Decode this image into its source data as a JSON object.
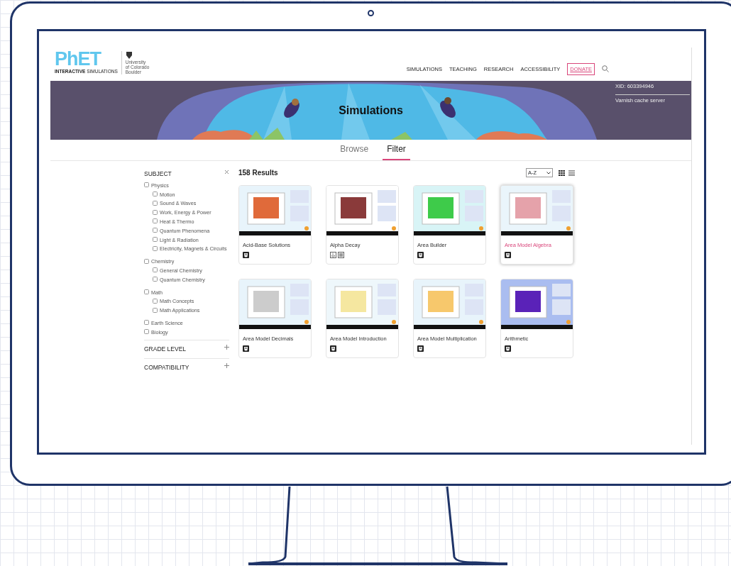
{
  "header": {
    "logo": {
      "name": "PhET",
      "tagline_bold": "INTERACTIVE",
      "tagline": "SIMULATIONS",
      "university": [
        "University",
        "of Colorado",
        "Boulder"
      ]
    },
    "nav": [
      {
        "label": "SIMULATIONS",
        "kind": "link"
      },
      {
        "label": "TEACHING",
        "kind": "link"
      },
      {
        "label": "RESEARCH",
        "kind": "link"
      },
      {
        "label": "ACCESSIBILITY",
        "kind": "link"
      },
      {
        "label": "DONATE",
        "kind": "outlined"
      }
    ]
  },
  "banner": {
    "title": "Simulations",
    "server_info": [
      "XID: 603394946",
      "Varnish cache server"
    ]
  },
  "tabs": [
    {
      "label": "Browse",
      "selected": false
    },
    {
      "label": "Filter",
      "selected": true
    }
  ],
  "filters": {
    "sections": [
      {
        "title": "SUBJECT",
        "expanded": true,
        "items": [
          {
            "label": "Physics",
            "checked": false,
            "children": [
              {
                "label": "Motion",
                "checked": false
              },
              {
                "label": "Sound & Waves",
                "checked": false
              },
              {
                "label": "Work, Energy & Power",
                "checked": false
              },
              {
                "label": "Heat & Thermo",
                "checked": false
              },
              {
                "label": "Quantum Phenomena",
                "checked": false
              },
              {
                "label": "Light & Radiation",
                "checked": false
              },
              {
                "label": "Electricity, Magnets & Circuits",
                "checked": false
              }
            ]
          },
          {
            "label": "Chemistry",
            "checked": false,
            "children": [
              {
                "label": "General Chemistry",
                "checked": false
              },
              {
                "label": "Quantum Chemistry",
                "checked": false
              }
            ]
          },
          {
            "label": "Math",
            "checked": false,
            "children": [
              {
                "label": "Math Concepts",
                "checked": false
              },
              {
                "label": "Math Applications",
                "checked": false
              }
            ]
          },
          {
            "label": "Earth Science",
            "checked": false
          },
          {
            "label": "Biology",
            "checked": false
          }
        ]
      },
      {
        "title": "GRADE LEVEL",
        "expanded": false
      },
      {
        "title": "COMPATIBILITY",
        "expanded": false
      }
    ]
  },
  "results": {
    "count": "158 Results",
    "sort": "A-Z",
    "views": [
      {
        "kind": "grid",
        "selected": true
      },
      {
        "kind": "list",
        "selected": false
      }
    ],
    "cards": [
      {
        "title": "Acid-Base Solutions",
        "hovered": false,
        "badges": [
          {
            "kind": "html5"
          }
        ]
      },
      {
        "title": "Alpha Decay",
        "hovered": false,
        "badges": [
          {
            "kind": "java"
          },
          {
            "kind": "flash"
          }
        ]
      },
      {
        "title": "Area Builder",
        "hovered": false,
        "badges": [
          {
            "kind": "html5"
          }
        ]
      },
      {
        "title": "Area Model Algebra",
        "hovered": true,
        "badges": [
          {
            "kind": "html5"
          }
        ]
      },
      {
        "title": "Area Model Decimals",
        "hovered": false,
        "badges": [
          {
            "kind": "html5"
          }
        ]
      },
      {
        "title": "Area Model Introduction",
        "hovered": false,
        "badges": [
          {
            "kind": "html5"
          }
        ]
      },
      {
        "title": "Area Model Multiplication",
        "hovered": false,
        "badges": [
          {
            "kind": "html5"
          }
        ]
      },
      {
        "title": "Arithmetic",
        "hovered": false,
        "badges": [
          {
            "kind": "html5"
          }
        ]
      }
    ]
  }
}
